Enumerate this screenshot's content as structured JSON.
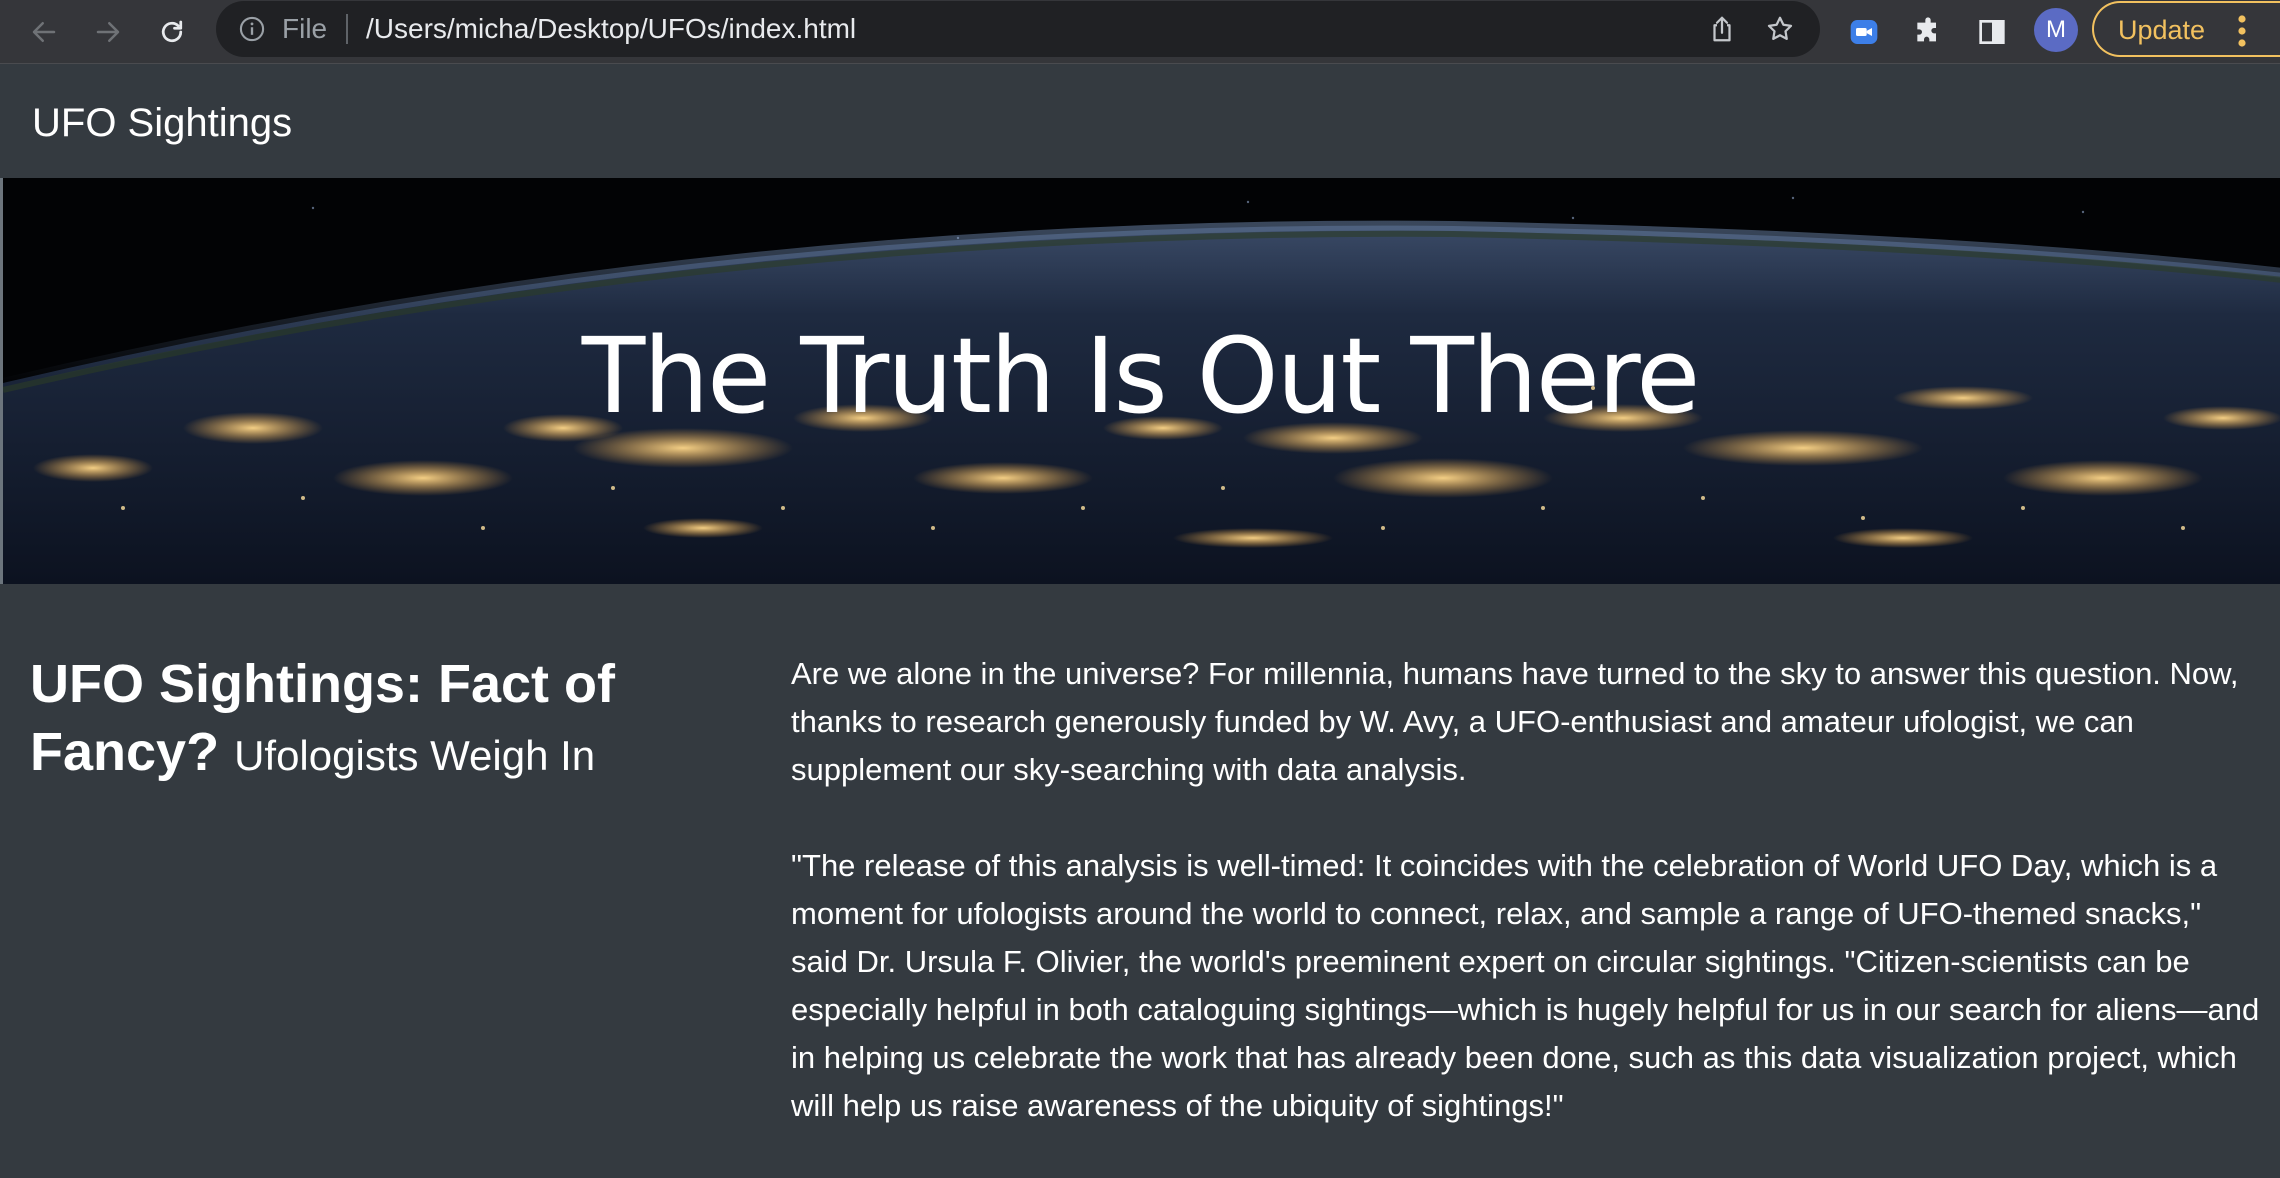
{
  "browser": {
    "omnibox": {
      "scheme_label": "File",
      "url": "/Users/micha/Desktop/UFOs/index.html"
    },
    "profile_initial": "M",
    "update_label": "Update",
    "colors": {
      "update_accent": "#f2c15f",
      "avatar": "#5b6bc4",
      "meet_ext": "#3d7fe8"
    }
  },
  "page": {
    "brand": "UFO Sightings",
    "hero_title": "The Truth Is Out There",
    "heading": {
      "main": "UFO Sightings: Fact of Fancy?",
      "sub": "Ufologists Weigh In"
    },
    "article": {
      "paragraphs": [
        "Are we alone in the universe? For millennia, humans have turned to the sky to answer this question. Now, thanks to research generously funded by W. Avy, a UFO-enthusiast and amateur ufologist, we can supplement our sky-searching with data analysis.",
        "\"The release of this analysis is well-timed: It coincides with the celebration of World UFO Day, which is a moment for ufologists around the world to connect, relax, and sample a range of UFO-themed snacks,\" said Dr. Ursula F. Olivier, the world's preeminent expert on circular sightings. \"Citizen-scientists can be especially helpful in both cataloguing sightings—which is hugely helpful for us in our search for aliens—and in helping us celebrate the work that has already been done, such as this data visualization project, which will help us raise awareness of the ubiquity of sightings!\""
      ]
    },
    "colors": {
      "background": "#343a40",
      "text": "#ffffff"
    }
  }
}
